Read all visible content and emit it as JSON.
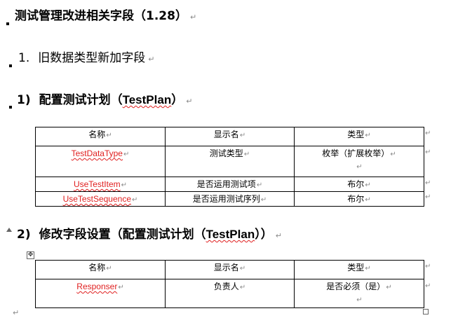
{
  "doc": {
    "title": "测试管理改进相关字段（1.28）",
    "section1": {
      "num": "1.",
      "text": "旧数据类型新加字段"
    },
    "section1_1": {
      "num": "1)",
      "text_a": "配置测试计划（",
      "code": "TestPlan",
      "text_b": "）"
    },
    "section1_2": {
      "num": "2)",
      "text_a": "修改字段设置（配置测试计划（",
      "code": "TestPlan",
      "text_b": "））"
    },
    "table1": {
      "headers": [
        "名称",
        "显示名",
        "类型"
      ],
      "rows": [
        [
          "TestDataType",
          "测试类型",
          "枚举（扩展枚举）"
        ],
        [
          "UseTestItem",
          "是否运用测试项",
          "布尔"
        ],
        [
          "UseTestSequence",
          "是否运用测试序列",
          "布尔"
        ]
      ]
    },
    "table2": {
      "headers": [
        "名称",
        "显示名",
        "类型"
      ],
      "rows": [
        [
          "Responser",
          "负责人",
          "是否必须（是）"
        ]
      ]
    },
    "marks": {
      "paragraph": "↵",
      "cell": "↵",
      "move_handle": "✥"
    }
  }
}
